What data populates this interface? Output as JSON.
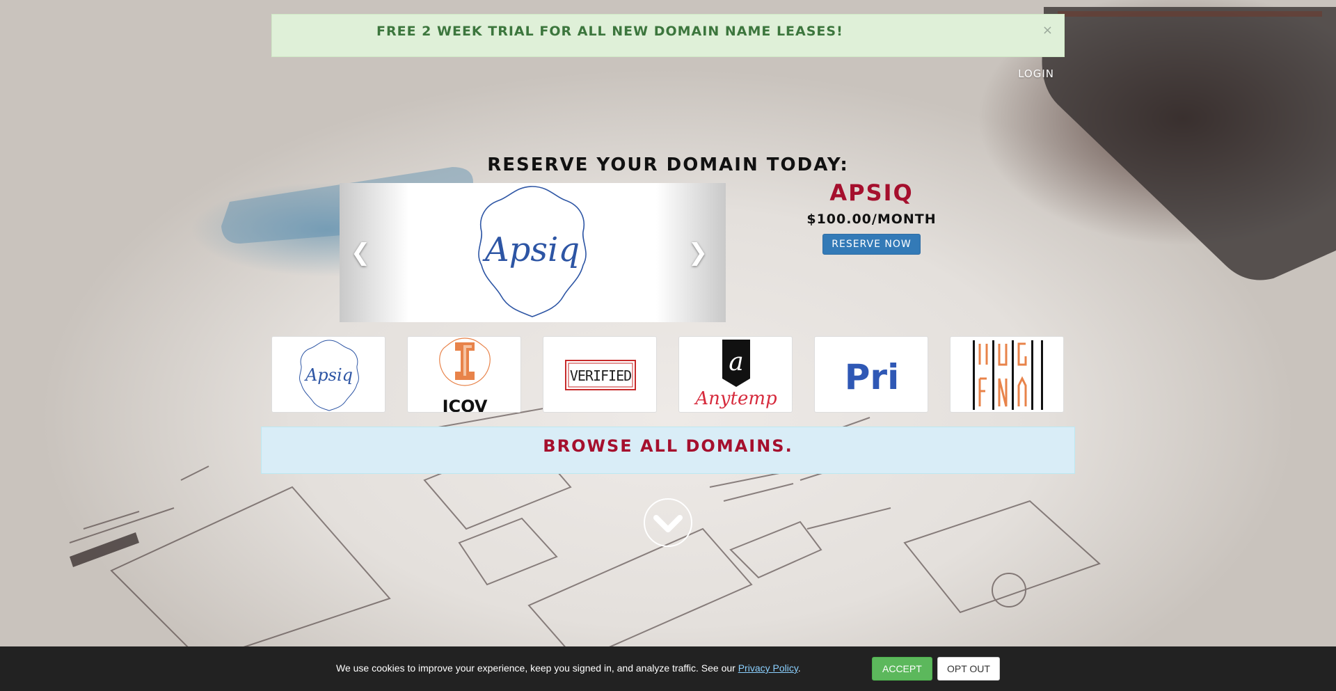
{
  "promo": {
    "text": "FREE 2 WEEK TRIAL FOR ALL NEW DOMAIN NAME LEASES!",
    "close_label": "×"
  },
  "nav": {
    "login_label": "LOGIN"
  },
  "hero": {
    "headline": "RESERVE YOUR DOMAIN TODAY:"
  },
  "carousel": {
    "current_logo_text": "Apsiq",
    "prev_icon": "chevron-left-icon",
    "next_icon": "chevron-right-icon"
  },
  "featured": {
    "name": "APSIQ",
    "price": "$100.00/MONTH",
    "reserve_label": "RESERVE NOW"
  },
  "thumbnails": [
    {
      "logo_text": "Apsiq"
    },
    {
      "logo_text": "ICOV"
    },
    {
      "logo_text": "VERIFIED"
    },
    {
      "logo_text": "Anytemp"
    },
    {
      "logo_text": "Pri"
    },
    {
      "logo_text": "VUGFMA"
    }
  ],
  "browse": {
    "label": "BROWSE ALL DOMAINS."
  },
  "scroll": {
    "icon": "chevron-down-circle-icon"
  },
  "cookie": {
    "text_before": "We use cookies to improve your experience, keep you signed in, and analyze traffic. See our ",
    "link_label": "Privacy Policy",
    "text_after": ".",
    "accept_label": "ACCEPT",
    "optout_label": "OPT OUT"
  },
  "colors": {
    "brand_red": "#a50f2d",
    "promo_green": "#3c763d",
    "button_blue": "#337ab7",
    "accept_green": "#5cb85c"
  }
}
